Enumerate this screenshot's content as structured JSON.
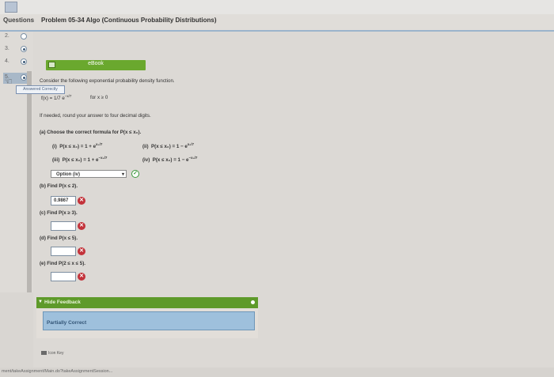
{
  "header": {
    "tab_label": "Questions",
    "problem_title": "Problem 05-34 Algo (Continuous Probability Distributions)"
  },
  "sidebar": {
    "items": [
      {
        "num": "2.",
        "filled": false
      },
      {
        "num": "3.",
        "filled": true
      },
      {
        "num": "4.",
        "filled": true
      },
      {
        "num": "5.",
        "filled": true
      }
    ]
  },
  "ebook": {
    "label": "eBook"
  },
  "answered_tag": "Answered Correctly",
  "problem": {
    "intro": "Consider the following exponential probability density function.",
    "pdf_lhs": "f(x) = ",
    "pdf_frac": "1/7",
    "pdf_exp": "e",
    "pdf_power": "−x/7",
    "pdf_domain": "for x ≥ 0",
    "round_note": "If needed, round your answer to four decimal digits."
  },
  "part_a": {
    "prompt": "(a) Choose the correct formula for P(x ≤ x₀).",
    "options": [
      {
        "num": "(i)",
        "text": "P(x ≤ x₀) = 1 + e",
        "power": "x₀/7"
      },
      {
        "num": "(ii)",
        "text": "P(x ≤ x₀) = 1 − e",
        "power": "x₀/7"
      },
      {
        "num": "(iii)",
        "text": "P(x ≤ x₀) = 1 + e",
        "power": "−x₀/7"
      },
      {
        "num": "(iv)",
        "text": "P(x ≤ x₀) = 1 − e",
        "power": "−x₀/7"
      }
    ],
    "selected": "Option (iv)"
  },
  "part_b": {
    "prompt": "(b) Find P(x ≤ 2).",
    "value": "0.9867"
  },
  "part_c": {
    "prompt": "(c) Find P(x ≥ 3).",
    "value": ""
  },
  "part_d": {
    "prompt": "(d) Find P(x ≤ 5).",
    "value": ""
  },
  "part_e": {
    "prompt": "(e) Find P(2 ≤ x ≤ 5).",
    "value": ""
  },
  "feedback": {
    "toggle_label": "Hide Feedback",
    "status": "Partially Correct"
  },
  "icon_key": "Icon Key",
  "statusbar": "ment/takeAssignment/Main.do?takeAssignmentSession..."
}
